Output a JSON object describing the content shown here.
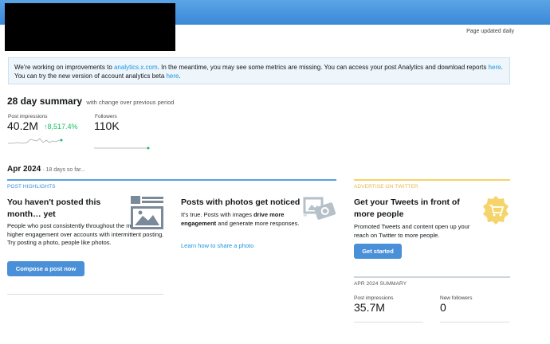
{
  "header": {
    "updated_text": "Page updated daily"
  },
  "notice": {
    "text_1": "We're working on improvements to ",
    "link_1": "analytics.x.com",
    "text_2": ". In the meantime, you may see some metrics are missing. You can access your post Analytics and download reports ",
    "link_2": "here",
    "text_3": ". You can try the new version of account analytics beta ",
    "link_3": "here",
    "text_4": "."
  },
  "summary": {
    "title": "28 day summary",
    "subtitle": "with change over previous period",
    "impressions": {
      "label": "Post impressions",
      "value": "40.2M",
      "delta": "↑8,517.4%"
    },
    "followers": {
      "label": "Followers",
      "value": "110K"
    }
  },
  "period": {
    "title": "Apr 2024",
    "subtitle": " · 18 days so far..."
  },
  "highlights": {
    "label": "POST HIGHLIGHTS",
    "card1": {
      "title": "You haven't posted this month… yet",
      "body": "People who post consistently throughout the month get higher engagement over accounts with intermittent posting. Try posting a photo, people like photos.",
      "button": "Compose a post now"
    },
    "card2": {
      "title": "Posts with photos get noticed",
      "body_1": "It's true. Posts with images ",
      "body_bold_1": "drive more engagement",
      "body_2": " and generate more responses.",
      "link": "Learn how to share a photo"
    }
  },
  "advertise": {
    "label": "ADVERTISE ON TWITTER",
    "title": "Get your Tweets in front of more people",
    "body": "Promoted Tweets and content open up your reach on Twitter to more people.",
    "button": "Get started"
  },
  "month_summary": {
    "label": "APR 2024 SUMMARY",
    "impressions_label": "Post impressions",
    "impressions_value": "35.7M",
    "followers_label": "New followers",
    "followers_value": "0"
  },
  "colors": {
    "accent": "#1b95e0",
    "positive": "#17bf63",
    "yellow": "#f5d46b"
  }
}
